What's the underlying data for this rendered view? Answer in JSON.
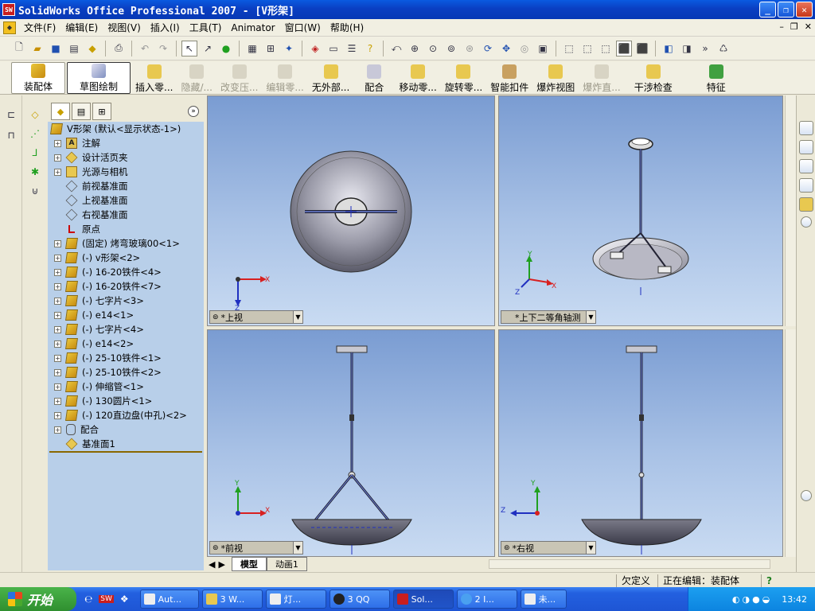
{
  "window": {
    "title": "SolidWorks Office Professional 2007 - [V形架]",
    "logo": "SW"
  },
  "menu": [
    "文件(F)",
    "编辑(E)",
    "视图(V)",
    "插入(I)",
    "工具(T)",
    "Animator",
    "窗口(W)",
    "帮助(H)"
  ],
  "command_manager": [
    {
      "label": "装配体",
      "state": "active"
    },
    {
      "label": "草图绘制",
      "state": "active"
    },
    {
      "label": "插入零...",
      "state": "normal"
    },
    {
      "label": "隐藏/...",
      "state": "disabled"
    },
    {
      "label": "改变压...",
      "state": "disabled"
    },
    {
      "label": "编辑零...",
      "state": "disabled"
    },
    {
      "label": "无外部...",
      "state": "normal"
    },
    {
      "label": "配合",
      "state": "normal"
    },
    {
      "label": "移动零...",
      "state": "normal"
    },
    {
      "label": "旋转零...",
      "state": "normal"
    },
    {
      "label": "智能扣件",
      "state": "normal"
    },
    {
      "label": "爆炸视图",
      "state": "normal"
    },
    {
      "label": "爆炸直...",
      "state": "disabled"
    },
    {
      "label": "干涉检查",
      "state": "normal"
    },
    {
      "label": "特征",
      "state": "normal"
    }
  ],
  "tree": {
    "root": "V形架  (默认<显示状态-1>)",
    "items": [
      {
        "label": "注解",
        "icon": "annotation-icon",
        "plus": true
      },
      {
        "label": "设计活页夹",
        "icon": "folder-icon",
        "plus": true
      },
      {
        "label": "光源与相机",
        "icon": "light-icon",
        "plus": true
      },
      {
        "label": "前视基准面",
        "icon": "plane-icon",
        "plus": false
      },
      {
        "label": "上视基准面",
        "icon": "plane-icon",
        "plus": false
      },
      {
        "label": "右视基准面",
        "icon": "plane-icon",
        "plus": false
      },
      {
        "label": "原点",
        "icon": "origin-icon",
        "plus": false
      },
      {
        "label": "(固定) 烤弯玻璃00<1>",
        "icon": "part-icon",
        "plus": true
      },
      {
        "label": "(-) v形架<2>",
        "icon": "part-icon",
        "plus": true
      },
      {
        "label": "(-) 16-20铁件<4>",
        "icon": "part-icon",
        "plus": true
      },
      {
        "label": "(-) 16-20铁件<7>",
        "icon": "part-icon",
        "plus": true
      },
      {
        "label": "(-) 七字片<3>",
        "icon": "part-icon",
        "plus": true
      },
      {
        "label": "(-) e14<1>",
        "icon": "part-icon",
        "plus": true
      },
      {
        "label": "(-) 七字片<4>",
        "icon": "part-icon",
        "plus": true
      },
      {
        "label": "(-) e14<2>",
        "icon": "part-icon",
        "plus": true
      },
      {
        "label": "(-) 25-10铁件<1>",
        "icon": "part-icon",
        "plus": true
      },
      {
        "label": "(-) 25-10铁件<2>",
        "icon": "part-icon",
        "plus": true
      },
      {
        "label": "(-) 伸缩管<1>",
        "icon": "part-icon",
        "plus": true
      },
      {
        "label": "(-) 130圆片<1>",
        "icon": "part-icon",
        "plus": true
      },
      {
        "label": "(-) 120直边盘(中孔)<2>",
        "icon": "part-icon",
        "plus": true
      },
      {
        "label": "配合",
        "icon": "mate-icon",
        "plus": true
      },
      {
        "label": "基准面1",
        "icon": "folder-icon",
        "plus": false
      }
    ]
  },
  "viewports": {
    "top_left": {
      "label": "*上视"
    },
    "top_right": {
      "label": "*上下二等角轴测"
    },
    "bottom_left": {
      "label": "*前视"
    },
    "bottom_right": {
      "label": "*右视"
    }
  },
  "axes": {
    "x": "X",
    "y": "Y",
    "z": "Z"
  },
  "doc_tabs": {
    "model": "模型",
    "animation": "动画1"
  },
  "status": {
    "defined": "欠定义",
    "editing": "正在编辑：装配体",
    "help": "?"
  },
  "taskbar": {
    "start": "开始",
    "items": [
      {
        "label": "Aut..."
      },
      {
        "label": "3 W..."
      },
      {
        "label": "灯..."
      },
      {
        "label": "3 QQ"
      },
      {
        "label": "Sol..."
      },
      {
        "label": "2 I..."
      },
      {
        "label": "未..."
      }
    ],
    "clock": "13:42"
  },
  "colors": {
    "accent": "#0a3fc2",
    "viewport_top": "#7a9cd2",
    "viewport_bottom": "#c9dbf2",
    "axis_x": "#d82020",
    "axis_y": "#20a020",
    "axis_z": "#2030c0"
  }
}
